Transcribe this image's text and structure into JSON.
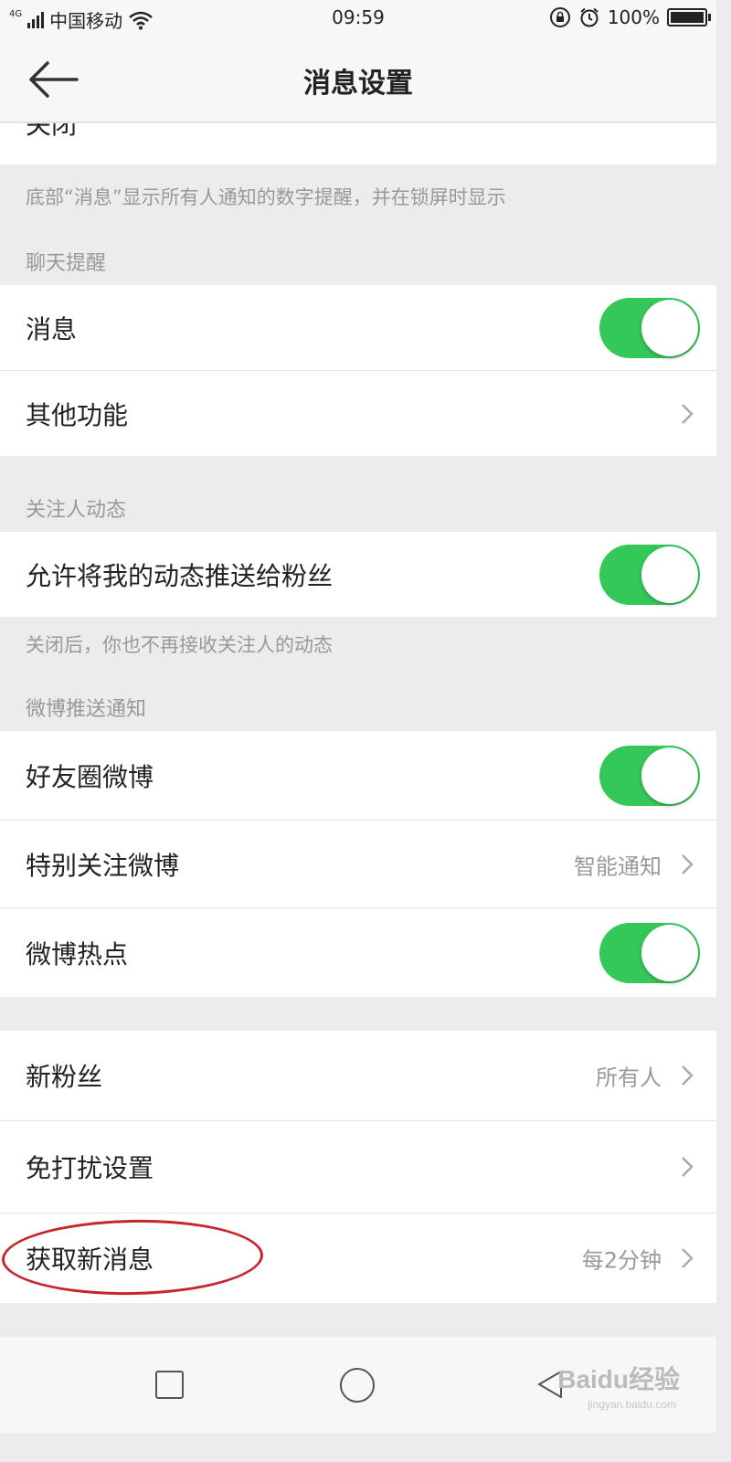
{
  "status_bar": {
    "network": "4G",
    "carrier": "中国移动",
    "time": "09:59",
    "battery": "100%"
  },
  "nav": {
    "title": "消息设置"
  },
  "top_cut_row": {
    "label": "关闭"
  },
  "notes": {
    "badge_note": "底部“消息”显示所有人通知的数字提醒，并在锁屏时显示",
    "follow_note": "关闭后，你也不再接收关注人的动态"
  },
  "sections": {
    "chat": "聊天提醒",
    "follow": "关注人动态",
    "weibo_push": "微博推送通知"
  },
  "rows": {
    "message": {
      "label": "消息",
      "toggle": true
    },
    "other": {
      "label": "其他功能"
    },
    "allow_push": {
      "label": "允许将我的动态推送给粉丝",
      "toggle": true
    },
    "friends": {
      "label": "好友圈微博",
      "toggle": true
    },
    "special": {
      "label": "特别关注微博",
      "value": "智能通知"
    },
    "hot": {
      "label": "微博热点",
      "toggle": true
    },
    "new_fans": {
      "label": "新粉丝",
      "value": "所有人"
    },
    "dnd": {
      "label": "免打扰设置"
    },
    "fetch": {
      "label": "获取新消息",
      "value": "每2分钟"
    }
  },
  "watermark": {
    "brand": "Baidu经验",
    "url": "jingyan.baidu.com"
  },
  "colors": {
    "toggle_on": "#34c759",
    "annotation": "#c8242c"
  }
}
